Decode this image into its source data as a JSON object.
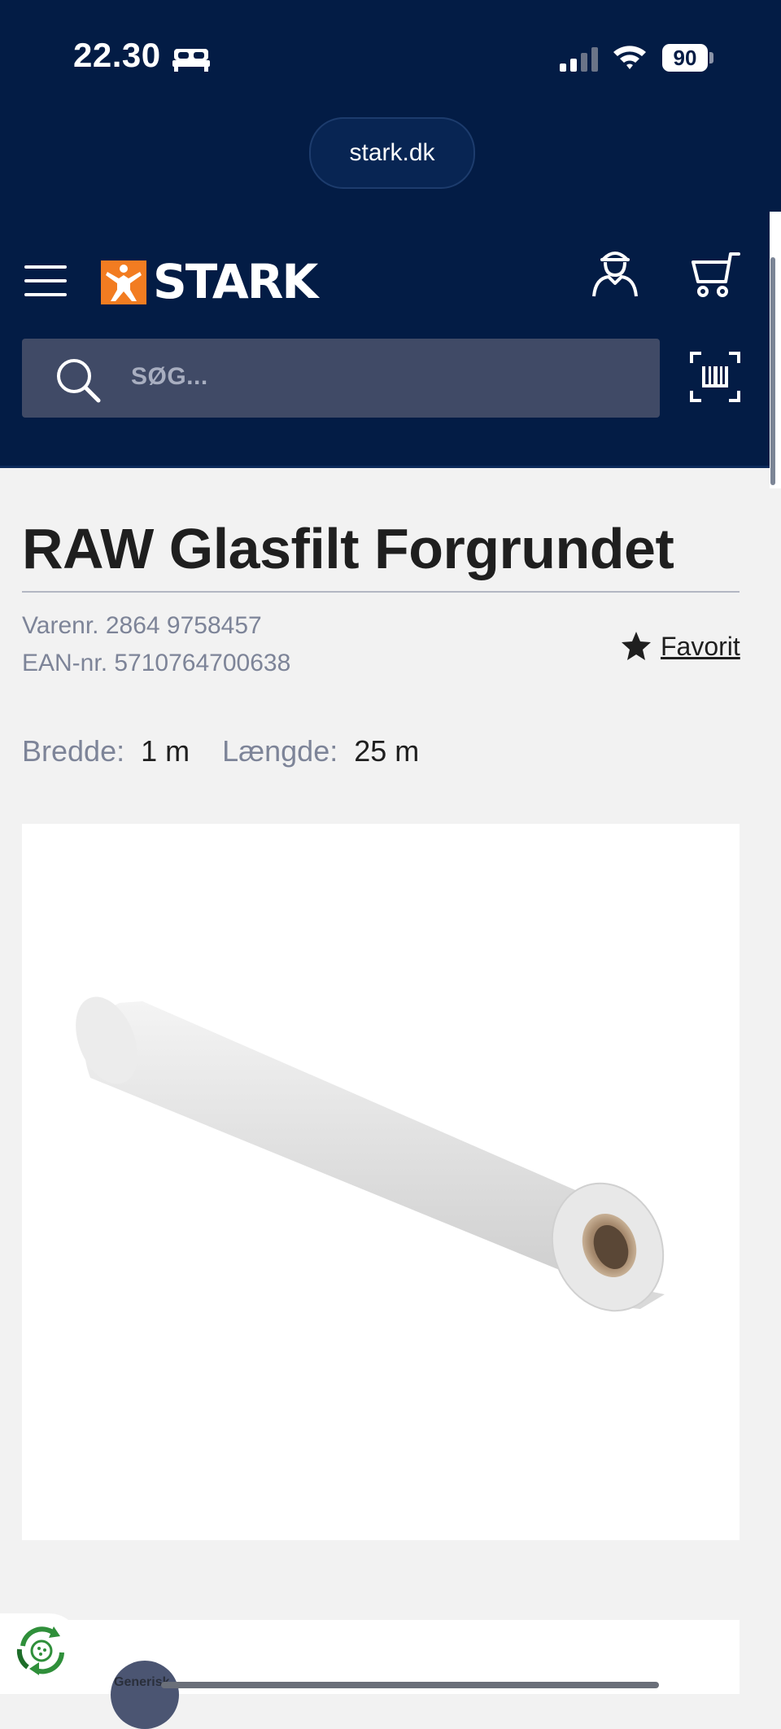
{
  "status_bar": {
    "time": "22.30",
    "battery": "90",
    "icons": [
      "bed-icon",
      "signal-icon",
      "wifi-icon",
      "battery-icon"
    ]
  },
  "browser": {
    "url": "stark.dk"
  },
  "header": {
    "logo_text": "STARK",
    "search_placeholder": "SØG...",
    "icons": [
      "menu-icon",
      "stark-logo-icon",
      "account-icon",
      "cart-icon",
      "search-icon",
      "barcode-scan-icon"
    ]
  },
  "product": {
    "title": "RAW Glasfilt Forgrundet",
    "varenr": "Varenr. 2864 9758457",
    "ean": "EAN-nr. 5710764700638",
    "favorite_label": "Favorit",
    "specs": [
      {
        "label": "Bredde:",
        "value": "1 m"
      },
      {
        "label": "Længde:",
        "value": "25 m"
      }
    ],
    "image_alt_icon": "fiberglass-roll-image"
  },
  "footer": {
    "generic_label": "Generisk",
    "icons": [
      "eco-recycle-icon"
    ]
  },
  "colors": {
    "header_bg": "#031c45",
    "search_bg": "#404a66",
    "brand_orange": "#f27c21",
    "page_bg": "#f2f2f2",
    "muted_text": "#7d8498"
  }
}
